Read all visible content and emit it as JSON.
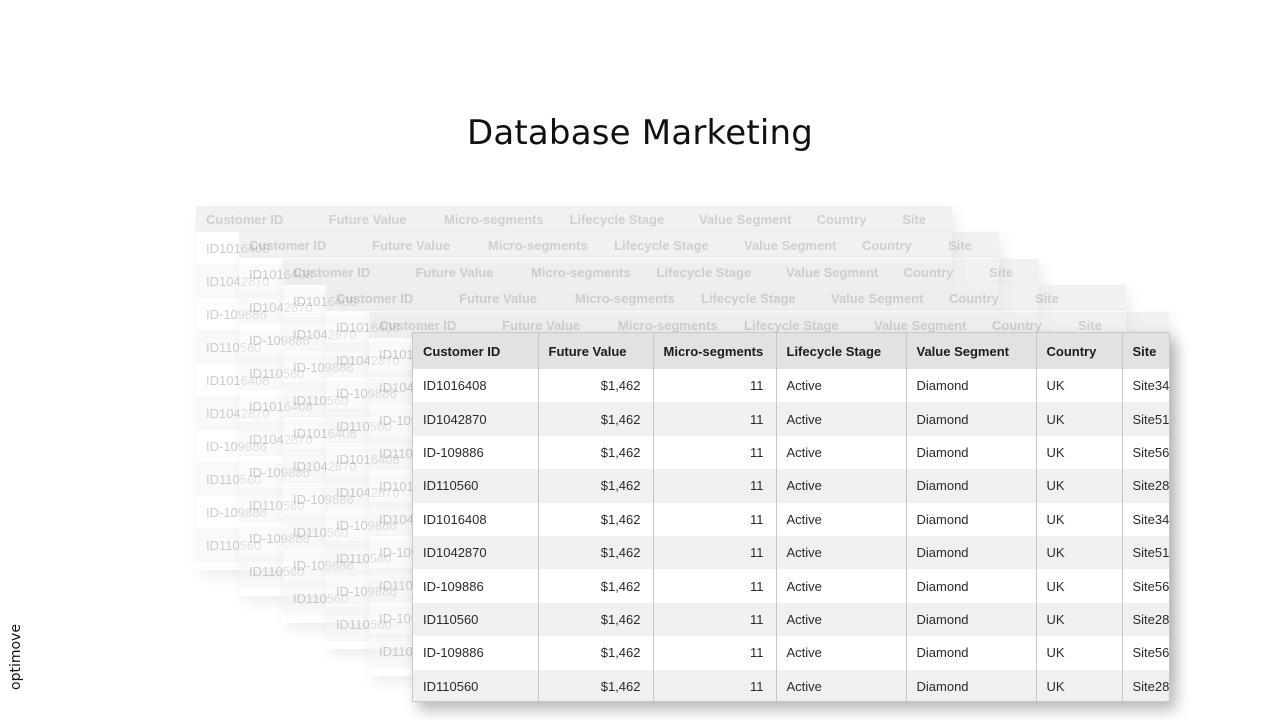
{
  "title": "Database Marketing",
  "logo": "optimove",
  "columns": [
    "Customer ID",
    "Future Value",
    "Micro-segments",
    "Lifecycle Stage",
    "Value Segment",
    "Country",
    "Site"
  ],
  "rows": [
    {
      "id": "ID1016408",
      "future_value": "$1,462",
      "micro_segments": "11",
      "lifecycle": "Active",
      "value_segment": "Diamond",
      "country": "UK",
      "site": "Site34"
    },
    {
      "id": "ID1042870",
      "future_value": "$1,462",
      "micro_segments": "11",
      "lifecycle": "Active",
      "value_segment": "Diamond",
      "country": "UK",
      "site": "Site51"
    },
    {
      "id": "ID-109886",
      "future_value": "$1,462",
      "micro_segments": "11",
      "lifecycle": "Active",
      "value_segment": "Diamond",
      "country": "UK",
      "site": "Site56"
    },
    {
      "id": "ID110560",
      "future_value": "$1,462",
      "micro_segments": "11",
      "lifecycle": "Active",
      "value_segment": "Diamond",
      "country": "UK",
      "site": "Site28"
    },
    {
      "id": "ID1016408",
      "future_value": "$1,462",
      "micro_segments": "11",
      "lifecycle": "Active",
      "value_segment": "Diamond",
      "country": "UK",
      "site": "Site34"
    },
    {
      "id": "ID1042870",
      "future_value": "$1,462",
      "micro_segments": "11",
      "lifecycle": "Active",
      "value_segment": "Diamond",
      "country": "UK",
      "site": "Site51"
    },
    {
      "id": "ID-109886",
      "future_value": "$1,462",
      "micro_segments": "11",
      "lifecycle": "Active",
      "value_segment": "Diamond",
      "country": "UK",
      "site": "Site56"
    },
    {
      "id": "ID110560",
      "future_value": "$1,462",
      "micro_segments": "11",
      "lifecycle": "Active",
      "value_segment": "Diamond",
      "country": "UK",
      "site": "Site28"
    },
    {
      "id": "ID-109886",
      "future_value": "$1,462",
      "micro_segments": "11",
      "lifecycle": "Active",
      "value_segment": "Diamond",
      "country": "UK",
      "site": "Site56"
    },
    {
      "id": "ID110560",
      "future_value": "$1,462",
      "micro_segments": "11",
      "lifecycle": "Active",
      "value_segment": "Diamond",
      "country": "UK",
      "site": "Site28"
    }
  ],
  "background_tables": [
    {
      "ids": [
        "ID1016408",
        "ID1042870",
        "ID-109886",
        "ID110560",
        "ID1016408",
        "ID1042870",
        "ID-109886",
        "ID110560",
        "ID-109886",
        "ID110560"
      ]
    },
    {
      "ids": [
        "ID1016408",
        "ID1042870",
        "ID-109886",
        "ID110560",
        "ID1016408",
        "ID1042870",
        "ID-109886",
        "ID110560",
        "ID-109886",
        "ID110560"
      ]
    },
    {
      "ids": [
        "ID1016408",
        "ID1042870",
        "ID-109886",
        "ID110560",
        "ID1016408",
        "ID1042870",
        "ID-109886",
        "ID110560",
        "ID-109886",
        "ID110560"
      ]
    },
    {
      "ids": [
        "ID1016408",
        "ID1042870",
        "ID-109886",
        "ID110560",
        "ID1016408",
        "ID1042870",
        "ID-109886",
        "ID110560",
        "ID-109886",
        "ID110560"
      ]
    },
    {
      "ids": [
        "ID1016408",
        "ID1042870",
        "ID-109886",
        "ID110560",
        "ID1016408",
        "ID1042870",
        "ID-109886",
        "ID110560",
        "ID-109886",
        "ID110560"
      ]
    }
  ]
}
